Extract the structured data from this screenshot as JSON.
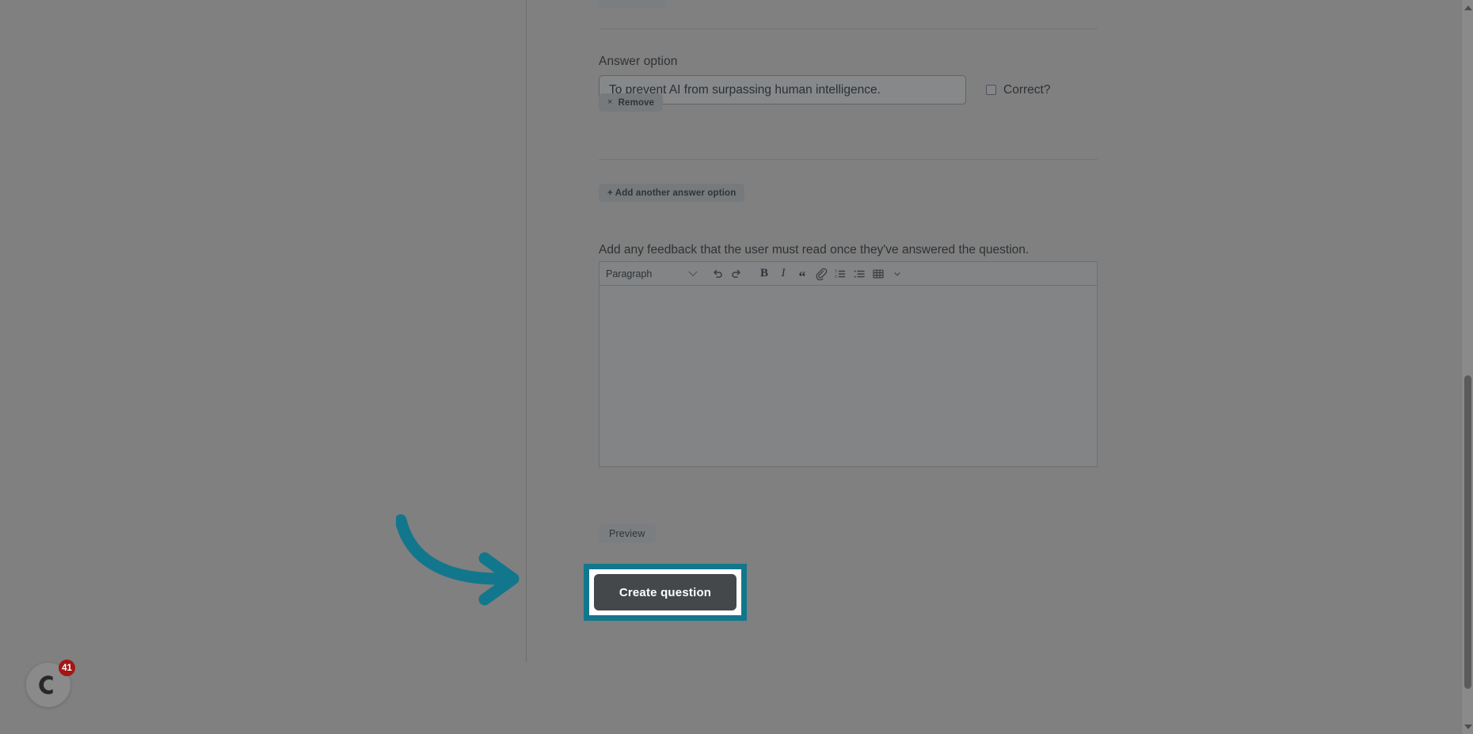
{
  "theme": {
    "background": "#808080",
    "accent_teal": "#12778c",
    "button_dark": "#45484a",
    "badge_red": "#a21616",
    "text": "#2d3236"
  },
  "answer_option": {
    "label": "Answer option",
    "value": "To prevent AI from surpassing human intelligence.",
    "placeholder": "",
    "correct_label": "Correct?",
    "correct_checked": false,
    "remove_label": "Remove",
    "remove_icon": "×"
  },
  "add_option": {
    "label": "+ Add another answer option"
  },
  "feedback": {
    "label": "Add any feedback that the user must read once they've answered the question.",
    "body_value": "",
    "preview_label": "Preview",
    "toolbar": {
      "block_format": "Paragraph",
      "items": [
        {
          "name": "undo-icon",
          "title": "Undo"
        },
        {
          "name": "redo-icon",
          "title": "Redo"
        },
        {
          "name": "bold-icon",
          "title": "Bold",
          "glyph": "B"
        },
        {
          "name": "italic-icon",
          "title": "Italic",
          "glyph": "I"
        },
        {
          "name": "blockquote-icon",
          "title": "Blockquote",
          "glyph": "“"
        },
        {
          "name": "link-icon",
          "title": "Link"
        },
        {
          "name": "ordered-list-icon",
          "title": "Numbered list"
        },
        {
          "name": "bullet-list-icon",
          "title": "Bulleted list"
        },
        {
          "name": "table-icon",
          "title": "Table"
        }
      ]
    }
  },
  "submit": {
    "label": "Create question"
  },
  "chat_widget": {
    "badge_count": "41",
    "icon": "chat-icon"
  },
  "scrollbar": {
    "up_icon": "caret-up-icon",
    "down_icon": "caret-down-icon"
  }
}
